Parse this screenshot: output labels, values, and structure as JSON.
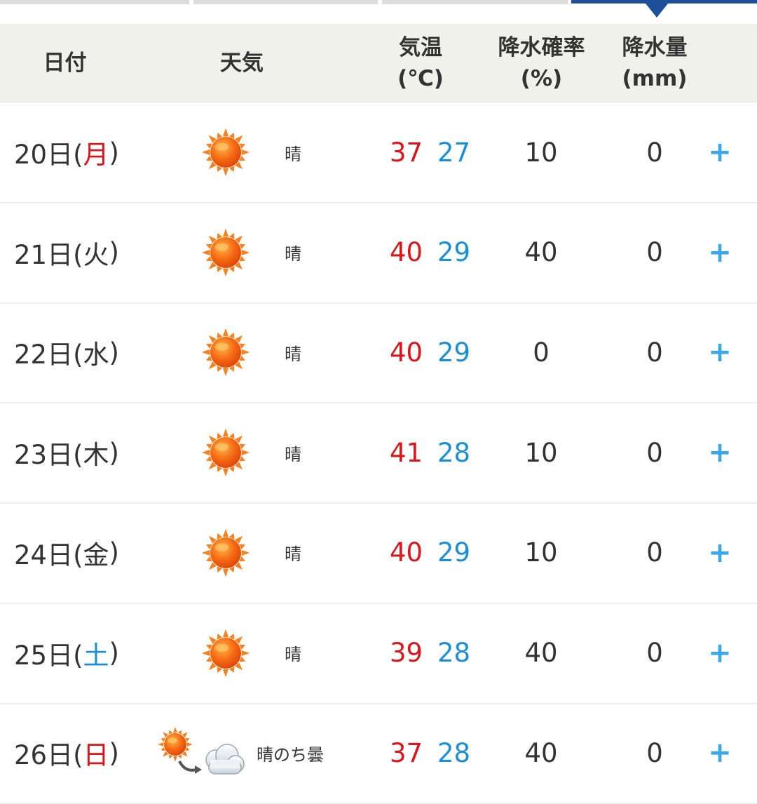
{
  "header": {
    "date": "日付",
    "weather": "天気",
    "temp_line1": "気温",
    "temp_line2": "(℃)",
    "prob_line1": "降水確率",
    "prob_line2": "(%)",
    "amt_line1": "降水量",
    "amt_line2": "(mm)"
  },
  "colors": {
    "max_temp": "#d9161c",
    "min_temp": "#1b8fd6",
    "sunday": "#d9161c",
    "saturday": "#1b8fd6",
    "expand": "#3aa7e8",
    "active_tab": "#1d4f9b"
  },
  "rows": [
    {
      "day": "20日(",
      "weekday": "月",
      "close": ")",
      "weekday_color": "#d9161c",
      "icon": "sun-icon",
      "weather": "晴",
      "max": "37",
      "min": "27",
      "prob": "10",
      "amt": "0",
      "expand": "+"
    },
    {
      "day": "21日(",
      "weekday": "火",
      "close": ")",
      "weekday_color": "#333333",
      "icon": "sun-icon",
      "weather": "晴",
      "max": "40",
      "min": "29",
      "prob": "40",
      "amt": "0",
      "expand": "+"
    },
    {
      "day": "22日(",
      "weekday": "水",
      "close": ")",
      "weekday_color": "#333333",
      "icon": "sun-icon",
      "weather": "晴",
      "max": "40",
      "min": "29",
      "prob": "0",
      "amt": "0",
      "expand": "+"
    },
    {
      "day": "23日(",
      "weekday": "木",
      "close": ")",
      "weekday_color": "#333333",
      "icon": "sun-icon",
      "weather": "晴",
      "max": "41",
      "min": "28",
      "prob": "10",
      "amt": "0",
      "expand": "+"
    },
    {
      "day": "24日(",
      "weekday": "金",
      "close": ")",
      "weekday_color": "#333333",
      "icon": "sun-icon",
      "weather": "晴",
      "max": "40",
      "min": "29",
      "prob": "10",
      "amt": "0",
      "expand": "+"
    },
    {
      "day": "25日(",
      "weekday": "土",
      "close": ")",
      "weekday_color": "#1b8fd6",
      "icon": "sun-icon",
      "weather": "晴",
      "max": "39",
      "min": "28",
      "prob": "40",
      "amt": "0",
      "expand": "+"
    },
    {
      "day": "26日(",
      "weekday": "日",
      "close": ")",
      "weekday_color": "#d9161c",
      "icon": "sun-then-cloud-icon",
      "weather": "晴のち曇",
      "max": "37",
      "min": "28",
      "prob": "40",
      "amt": "0",
      "expand": "+"
    }
  ]
}
